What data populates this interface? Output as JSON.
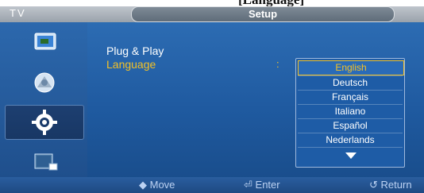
{
  "window": {
    "tv_label": "TV",
    "title": "Setup"
  },
  "cropped_header": {
    "text": "[Language]"
  },
  "sidebar": {
    "items": [
      {
        "icon": "picture-icon"
      },
      {
        "icon": "sound-icon"
      },
      {
        "icon": "setup-gear-icon",
        "selected": true
      },
      {
        "icon": "input-icon"
      }
    ]
  },
  "menu": {
    "items": [
      {
        "label": "Plug & Play"
      },
      {
        "label": "Language",
        "highlighted": true
      }
    ],
    "separator": ":"
  },
  "language_dropdown": {
    "selected": "English",
    "options": [
      "English",
      "Deutsch",
      "Français",
      "Italiano",
      "Español",
      "Nederlands"
    ],
    "more_icon": "down-triangle-icon"
  },
  "bottom_bar": {
    "move_label": "Move",
    "enter_label": "Enter",
    "return_label": "Return",
    "icons": [
      "move-diamond-icon",
      "enter-icon",
      "return-icon"
    ]
  },
  "colors": {
    "highlight": "#f3c126",
    "background": "#1f5aa0",
    "header": "#9aa2ab"
  }
}
